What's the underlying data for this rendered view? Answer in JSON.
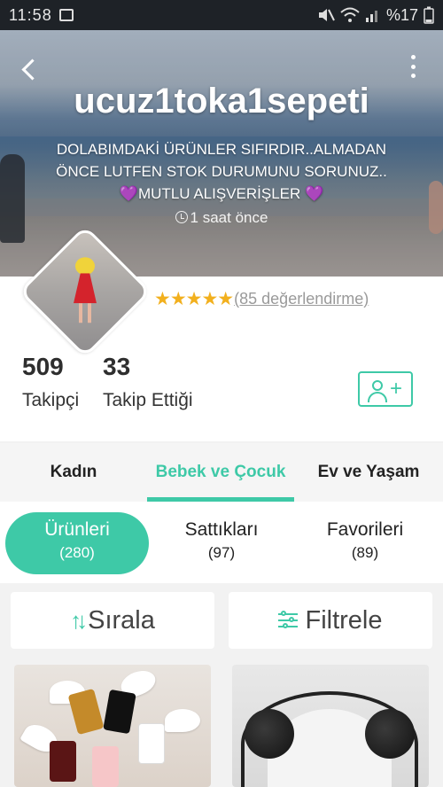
{
  "status_bar": {
    "time": "11:58",
    "battery": "%17"
  },
  "store": {
    "name": "ucuz1toka1sepeti",
    "description_line1": "DOLABIMDAKİ ÜRÜNLER SIFIRDIR..ALMADAN",
    "description_line2": "ÖNCE LUTFEN STOK DURUMUNU SORUNUZ..",
    "description_line3": "💜MUTLU ALIŞVERİŞLER 💜",
    "last_seen": "1 saat önce",
    "stars": "★★★★★",
    "rating_count": "(85 değerlendirme)"
  },
  "stats": {
    "followers": {
      "value": "509",
      "label": "Takipçi"
    },
    "following": {
      "value": "33",
      "label": "Takip Ettiği"
    }
  },
  "categories": [
    {
      "label": "Kadın",
      "active": false
    },
    {
      "label": "Bebek ve Çocuk",
      "active": true
    },
    {
      "label": "Ev ve Yaşam",
      "active": false
    }
  ],
  "sub_tabs": [
    {
      "label": "Ürünleri",
      "count": "(280)",
      "active": true
    },
    {
      "label": "Sattıkları",
      "count": "(97)",
      "active": false
    },
    {
      "label": "Favorileri",
      "count": "(89)",
      "active": false
    }
  ],
  "toolbar": {
    "sort_label": "Sırala",
    "filter_label": "Filtrele"
  },
  "colors": {
    "accent": "#3ec9a7",
    "star": "#f2b01e",
    "status_bar": "#1e2227"
  },
  "icons": [
    "back-arrow-icon",
    "more-vert-icon",
    "clock-icon",
    "star-icon",
    "add-person-icon",
    "sort-icon",
    "filter-icon",
    "mute-icon",
    "wifi-icon",
    "signal-icon",
    "battery-icon",
    "image-icon"
  ]
}
